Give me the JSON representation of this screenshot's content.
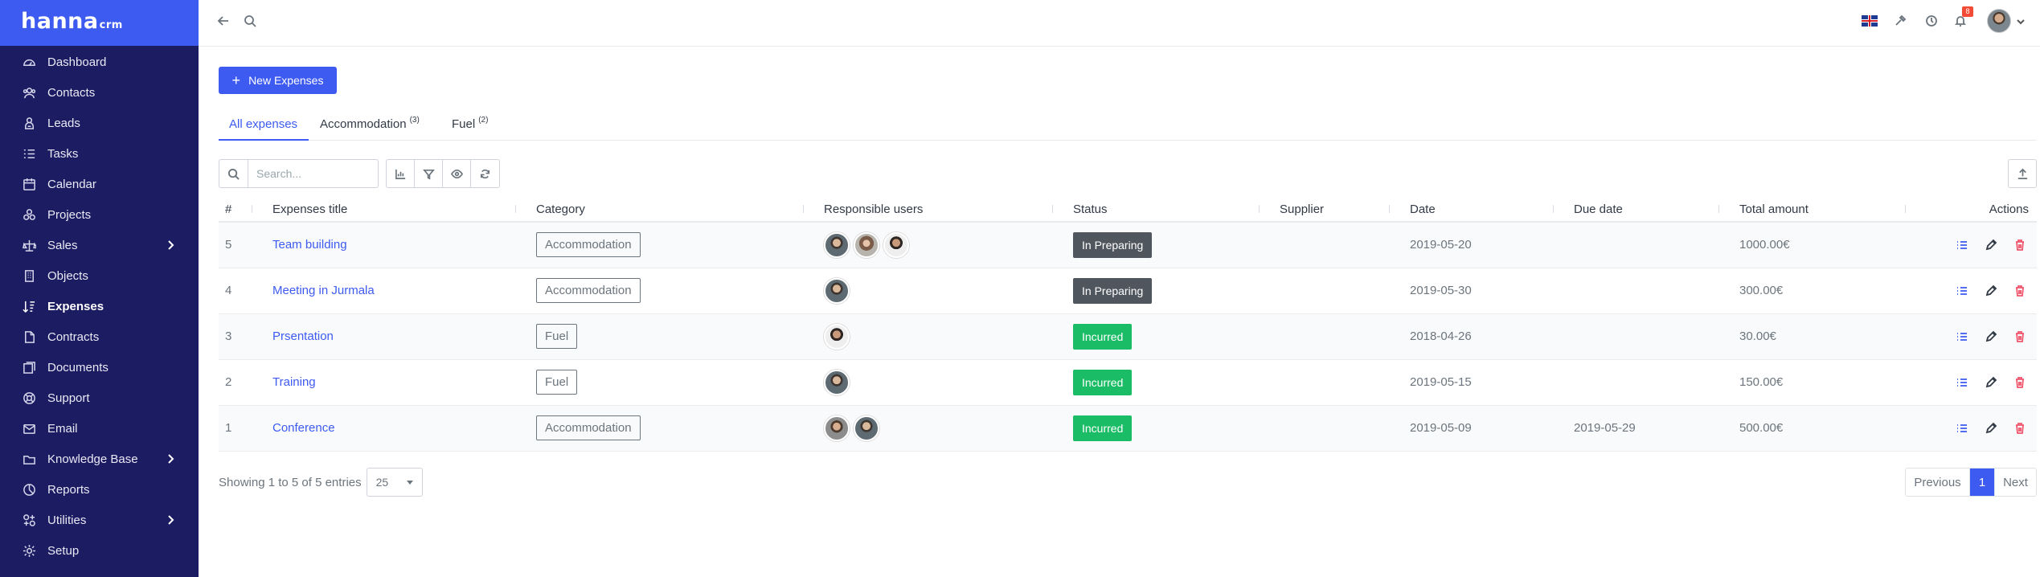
{
  "app": {
    "logo_main": "hanna",
    "logo_sub": "crm"
  },
  "sidebar": {
    "items": [
      {
        "label": "Dashboard",
        "icon": "dashboard-icon"
      },
      {
        "label": "Contacts",
        "icon": "contacts-icon"
      },
      {
        "label": "Leads",
        "icon": "leads-icon"
      },
      {
        "label": "Tasks",
        "icon": "tasks-icon"
      },
      {
        "label": "Calendar",
        "icon": "calendar-icon"
      },
      {
        "label": "Projects",
        "icon": "projects-icon"
      },
      {
        "label": "Sales",
        "icon": "sales-icon",
        "has_submenu": true
      },
      {
        "label": "Objects",
        "icon": "objects-icon"
      },
      {
        "label": "Expenses",
        "icon": "expenses-icon",
        "active": true
      },
      {
        "label": "Contracts",
        "icon": "contracts-icon"
      },
      {
        "label": "Documents",
        "icon": "documents-icon"
      },
      {
        "label": "Support",
        "icon": "support-icon"
      },
      {
        "label": "Email",
        "icon": "email-icon"
      },
      {
        "label": "Knowledge Base",
        "icon": "knowledge-base-icon",
        "has_submenu": true
      },
      {
        "label": "Reports",
        "icon": "reports-icon"
      },
      {
        "label": "Utilities",
        "icon": "utilities-icon",
        "has_submenu": true
      },
      {
        "label": "Setup",
        "icon": "setup-icon"
      }
    ]
  },
  "topbar": {
    "notification_count": "8",
    "language_flag": "uk-flag-icon"
  },
  "main": {
    "new_button_label": "New Expenses",
    "tabs": [
      {
        "label": "All expenses",
        "count": "",
        "active": true
      },
      {
        "label": "Accommodation",
        "count": "(3)"
      },
      {
        "label": "Fuel",
        "count": "(2)"
      }
    ],
    "search": {
      "placeholder": "Search...",
      "value": ""
    }
  },
  "table": {
    "columns": [
      "#",
      "Expenses title",
      "Category",
      "Responsible users",
      "Status",
      "Supplier",
      "Date",
      "Due date",
      "Total amount",
      "Actions"
    ],
    "rows": [
      {
        "id": "5",
        "title": "Team building",
        "category": "Accommodation",
        "users": [
          "a1",
          "a2",
          "a3"
        ],
        "status": "In Preparing",
        "status_type": "preparing",
        "supplier": "",
        "date": "2019-05-20",
        "due_date": "",
        "total": "1000.00€"
      },
      {
        "id": "4",
        "title": "Meeting in Jurmala",
        "category": "Accommodation",
        "users": [
          "a1"
        ],
        "status": "In Preparing",
        "status_type": "preparing",
        "supplier": "",
        "date": "2019-05-30",
        "due_date": "",
        "total": "300.00€"
      },
      {
        "id": "3",
        "title": "Prsentation",
        "category": "Fuel",
        "users": [
          "a3"
        ],
        "status": "Incurred",
        "status_type": "incurred",
        "supplier": "",
        "date": "2018-04-26",
        "due_date": "",
        "total": "30.00€"
      },
      {
        "id": "2",
        "title": "Training",
        "category": "Fuel",
        "users": [
          "a1"
        ],
        "status": "Incurred",
        "status_type": "incurred",
        "supplier": "",
        "date": "2019-05-15",
        "due_date": "",
        "total": "150.00€"
      },
      {
        "id": "1",
        "title": "Conference",
        "category": "Accommodation",
        "users": [
          "a4",
          "a1"
        ],
        "status": "Incurred",
        "status_type": "incurred",
        "supplier": "",
        "date": "2019-05-09",
        "due_date": "2019-05-29",
        "total": "500.00€"
      }
    ]
  },
  "footer": {
    "info": "Showing 1 to 5 of 5 entries",
    "page_size": "25",
    "prev_label": "Previous",
    "current_page": "1",
    "next_label": "Next"
  },
  "colors": {
    "primary": "#3d5af1",
    "sidebar_bg": "#1c1c63",
    "status_preparing": "#4f565e",
    "status_incurred": "#1abc65",
    "delete": "#f1556c"
  }
}
